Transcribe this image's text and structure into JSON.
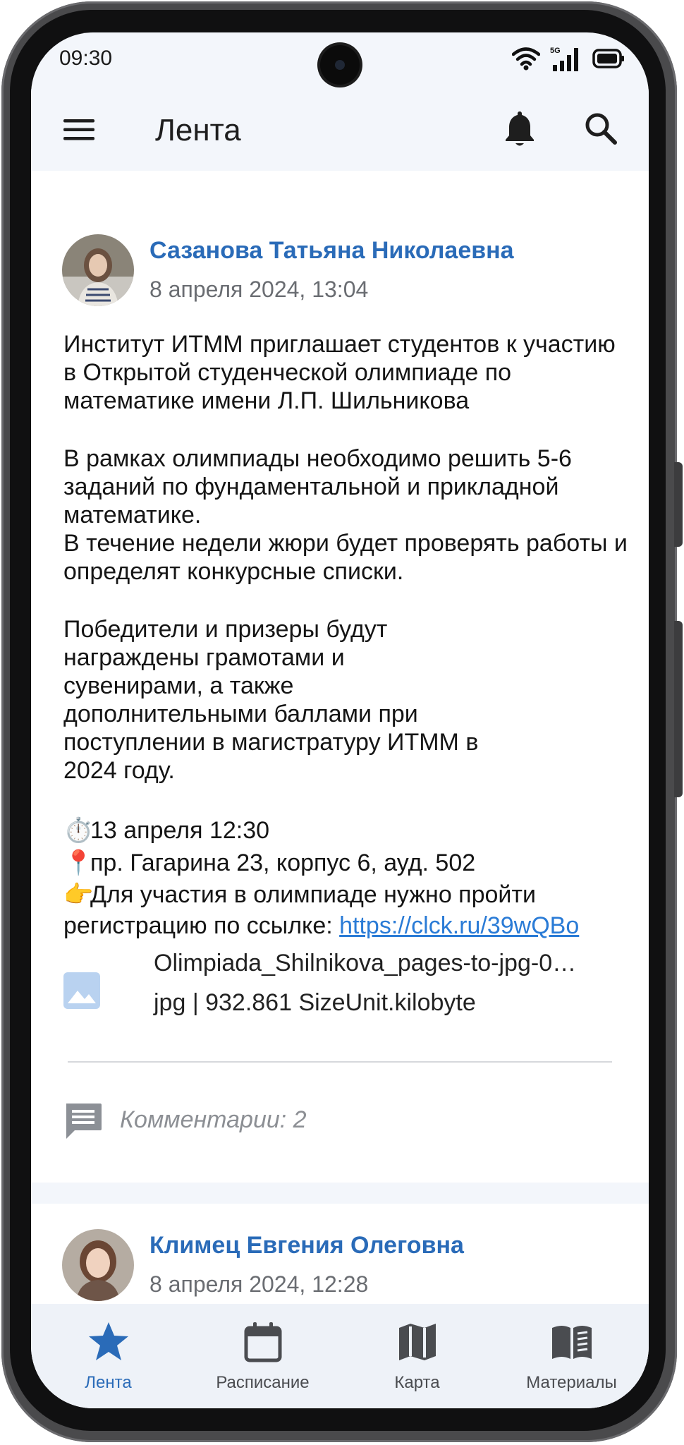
{
  "status_bar": {
    "time": "09:30",
    "network": "5G"
  },
  "app_bar": {
    "title": "Лента"
  },
  "posts": [
    {
      "author": "Сазанова Татьяна Николаевна",
      "date": "8 апреля 2024, 13:04",
      "paragraph_1": "Институт ИТММ приглашает студентов к участию в Открытой студенческой олимпиаде по математике имени Л.П. Шильникова",
      "paragraph_2a": "В рамках олимпиады необходимо решить 5-6 заданий по фундаментальной и прикладной математике.",
      "paragraph_2b": "В течение недели жюри будет проверять работы и определят конкурсные списки.",
      "paragraph_3": "Победители и призеры будут награждены грамотами и сувенирами, а также дополнительными баллами при поступлении в магистратуру  ИТММ в 2024 году.",
      "when_emoji": "⏱️",
      "when": "13 апреля 12:30",
      "where_emoji": "📍",
      "where": "пр. Гагарина 23, корпус 6, ауд. 502",
      "register_emoji": "👉",
      "register_text": "Для участия в олимпиаде нужно пройти регистрацию по ссылке: ",
      "register_link": "https://clck.ru/39wQBo",
      "attachment": {
        "name": "Olimpiada_Shilnikova_pages-to-jpg-0…",
        "meta": "jpg | 932.861 SizeUnit.kilobyte",
        "icon": "image-icon"
      },
      "comments": "Комментарии: 2"
    },
    {
      "author": "Климец Евгения Олеговна",
      "date": "8 апреля 2024, 12:28"
    }
  ],
  "bottom_nav": [
    {
      "label": "Лента",
      "icon": "star-icon",
      "active": true
    },
    {
      "label": "Расписание",
      "icon": "calendar-icon",
      "active": false
    },
    {
      "label": "Карта",
      "icon": "map-icon",
      "active": false
    },
    {
      "label": "Материалы",
      "icon": "book-icon",
      "active": false
    }
  ],
  "colors": {
    "accent": "#2a6bb8",
    "link": "#2a7bd6",
    "app_background": "#f3f6fb",
    "card_background": "#ffffff",
    "muted_text": "#6a6d72"
  }
}
